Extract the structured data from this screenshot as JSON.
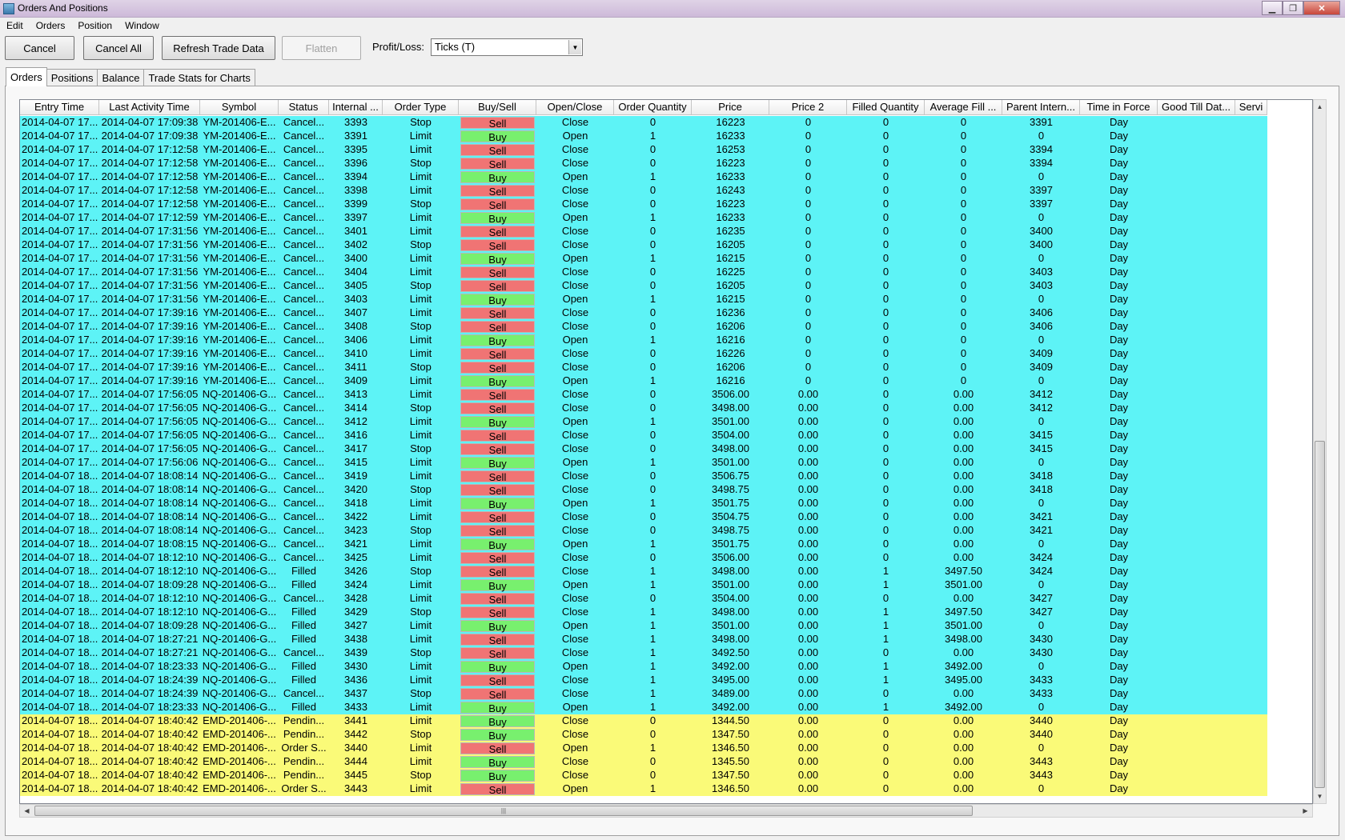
{
  "window": {
    "title": "Orders And Positions",
    "minimize": "▁",
    "restore": "❐",
    "close": "✕"
  },
  "menu": [
    "Edit",
    "Orders",
    "Position",
    "Window"
  ],
  "toolbar": {
    "cancel": "Cancel",
    "cancel_all": "Cancel All",
    "refresh": "Refresh Trade Data",
    "flatten": "Flatten",
    "pl_label": "Profit/Loss:",
    "pl_value": "Ticks (T)"
  },
  "tabs": [
    "Orders",
    "Positions",
    "Balance",
    "Trade Stats for Charts"
  ],
  "colors": {
    "cyan_row": "#5df3f6",
    "yellow_row": "#fafa78",
    "sell": "#f07474",
    "buy": "#78f06e"
  },
  "columns": [
    "Entry Time",
    "Last Activity Time",
    "Symbol",
    "Status",
    "Internal ...",
    "Order Type",
    "Buy/Sell",
    "Open/Close",
    "Order Quantity",
    "Price",
    "Price 2",
    "Filled Quantity",
    "Average Fill ...",
    "Parent Intern...",
    "Time in Force",
    "Good Till Dat...",
    "Servi"
  ],
  "rows": [
    [
      "2014-04-07 17...",
      "2014-04-07 17:09:38",
      "YM-201406-E...",
      "Cancel...",
      "3393",
      "Stop",
      "Sell",
      "Close",
      "0",
      "16223",
      "0",
      "0",
      "0",
      "3391",
      "Day",
      "",
      ""
    ],
    [
      "2014-04-07 17...",
      "2014-04-07 17:09:38",
      "YM-201406-E...",
      "Cancel...",
      "3391",
      "Limit",
      "Buy",
      "Open",
      "1",
      "16233",
      "0",
      "0",
      "0",
      "0",
      "Day",
      "",
      ""
    ],
    [
      "2014-04-07 17...",
      "2014-04-07 17:12:58",
      "YM-201406-E...",
      "Cancel...",
      "3395",
      "Limit",
      "Sell",
      "Close",
      "0",
      "16253",
      "0",
      "0",
      "0",
      "3394",
      "Day",
      "",
      ""
    ],
    [
      "2014-04-07 17...",
      "2014-04-07 17:12:58",
      "YM-201406-E...",
      "Cancel...",
      "3396",
      "Stop",
      "Sell",
      "Close",
      "0",
      "16223",
      "0",
      "0",
      "0",
      "3394",
      "Day",
      "",
      ""
    ],
    [
      "2014-04-07 17...",
      "2014-04-07 17:12:58",
      "YM-201406-E...",
      "Cancel...",
      "3394",
      "Limit",
      "Buy",
      "Open",
      "1",
      "16233",
      "0",
      "0",
      "0",
      "0",
      "Day",
      "",
      ""
    ],
    [
      "2014-04-07 17...",
      "2014-04-07 17:12:58",
      "YM-201406-E...",
      "Cancel...",
      "3398",
      "Limit",
      "Sell",
      "Close",
      "0",
      "16243",
      "0",
      "0",
      "0",
      "3397",
      "Day",
      "",
      ""
    ],
    [
      "2014-04-07 17...",
      "2014-04-07 17:12:58",
      "YM-201406-E...",
      "Cancel...",
      "3399",
      "Stop",
      "Sell",
      "Close",
      "0",
      "16223",
      "0",
      "0",
      "0",
      "3397",
      "Day",
      "",
      ""
    ],
    [
      "2014-04-07 17...",
      "2014-04-07 17:12:59",
      "YM-201406-E...",
      "Cancel...",
      "3397",
      "Limit",
      "Buy",
      "Open",
      "1",
      "16233",
      "0",
      "0",
      "0",
      "0",
      "Day",
      "",
      ""
    ],
    [
      "2014-04-07 17...",
      "2014-04-07 17:31:56",
      "YM-201406-E...",
      "Cancel...",
      "3401",
      "Limit",
      "Sell",
      "Close",
      "0",
      "16235",
      "0",
      "0",
      "0",
      "3400",
      "Day",
      "",
      ""
    ],
    [
      "2014-04-07 17...",
      "2014-04-07 17:31:56",
      "YM-201406-E...",
      "Cancel...",
      "3402",
      "Stop",
      "Sell",
      "Close",
      "0",
      "16205",
      "0",
      "0",
      "0",
      "3400",
      "Day",
      "",
      ""
    ],
    [
      "2014-04-07 17...",
      "2014-04-07 17:31:56",
      "YM-201406-E...",
      "Cancel...",
      "3400",
      "Limit",
      "Buy",
      "Open",
      "1",
      "16215",
      "0",
      "0",
      "0",
      "0",
      "Day",
      "",
      ""
    ],
    [
      "2014-04-07 17...",
      "2014-04-07 17:31:56",
      "YM-201406-E...",
      "Cancel...",
      "3404",
      "Limit",
      "Sell",
      "Close",
      "0",
      "16225",
      "0",
      "0",
      "0",
      "3403",
      "Day",
      "",
      ""
    ],
    [
      "2014-04-07 17...",
      "2014-04-07 17:31:56",
      "YM-201406-E...",
      "Cancel...",
      "3405",
      "Stop",
      "Sell",
      "Close",
      "0",
      "16205",
      "0",
      "0",
      "0",
      "3403",
      "Day",
      "",
      ""
    ],
    [
      "2014-04-07 17...",
      "2014-04-07 17:31:56",
      "YM-201406-E...",
      "Cancel...",
      "3403",
      "Limit",
      "Buy",
      "Open",
      "1",
      "16215",
      "0",
      "0",
      "0",
      "0",
      "Day",
      "",
      ""
    ],
    [
      "2014-04-07 17...",
      "2014-04-07 17:39:16",
      "YM-201406-E...",
      "Cancel...",
      "3407",
      "Limit",
      "Sell",
      "Close",
      "0",
      "16236",
      "0",
      "0",
      "0",
      "3406",
      "Day",
      "",
      ""
    ],
    [
      "2014-04-07 17...",
      "2014-04-07 17:39:16",
      "YM-201406-E...",
      "Cancel...",
      "3408",
      "Stop",
      "Sell",
      "Close",
      "0",
      "16206",
      "0",
      "0",
      "0",
      "3406",
      "Day",
      "",
      ""
    ],
    [
      "2014-04-07 17...",
      "2014-04-07 17:39:16",
      "YM-201406-E...",
      "Cancel...",
      "3406",
      "Limit",
      "Buy",
      "Open",
      "1",
      "16216",
      "0",
      "0",
      "0",
      "0",
      "Day",
      "",
      ""
    ],
    [
      "2014-04-07 17...",
      "2014-04-07 17:39:16",
      "YM-201406-E...",
      "Cancel...",
      "3410",
      "Limit",
      "Sell",
      "Close",
      "0",
      "16226",
      "0",
      "0",
      "0",
      "3409",
      "Day",
      "",
      ""
    ],
    [
      "2014-04-07 17...",
      "2014-04-07 17:39:16",
      "YM-201406-E...",
      "Cancel...",
      "3411",
      "Stop",
      "Sell",
      "Close",
      "0",
      "16206",
      "0",
      "0",
      "0",
      "3409",
      "Day",
      "",
      ""
    ],
    [
      "2014-04-07 17...",
      "2014-04-07 17:39:16",
      "YM-201406-E...",
      "Cancel...",
      "3409",
      "Limit",
      "Buy",
      "Open",
      "1",
      "16216",
      "0",
      "0",
      "0",
      "0",
      "Day",
      "",
      ""
    ],
    [
      "2014-04-07 17...",
      "2014-04-07 17:56:05",
      "NQ-201406-G...",
      "Cancel...",
      "3413",
      "Limit",
      "Sell",
      "Close",
      "0",
      "3506.00",
      "0.00",
      "0",
      "0.00",
      "3412",
      "Day",
      "",
      ""
    ],
    [
      "2014-04-07 17...",
      "2014-04-07 17:56:05",
      "NQ-201406-G...",
      "Cancel...",
      "3414",
      "Stop",
      "Sell",
      "Close",
      "0",
      "3498.00",
      "0.00",
      "0",
      "0.00",
      "3412",
      "Day",
      "",
      ""
    ],
    [
      "2014-04-07 17...",
      "2014-04-07 17:56:05",
      "NQ-201406-G...",
      "Cancel...",
      "3412",
      "Limit",
      "Buy",
      "Open",
      "1",
      "3501.00",
      "0.00",
      "0",
      "0.00",
      "0",
      "Day",
      "",
      ""
    ],
    [
      "2014-04-07 17...",
      "2014-04-07 17:56:05",
      "NQ-201406-G...",
      "Cancel...",
      "3416",
      "Limit",
      "Sell",
      "Close",
      "0",
      "3504.00",
      "0.00",
      "0",
      "0.00",
      "3415",
      "Day",
      "",
      ""
    ],
    [
      "2014-04-07 17...",
      "2014-04-07 17:56:05",
      "NQ-201406-G...",
      "Cancel...",
      "3417",
      "Stop",
      "Sell",
      "Close",
      "0",
      "3498.00",
      "0.00",
      "0",
      "0.00",
      "3415",
      "Day",
      "",
      ""
    ],
    [
      "2014-04-07 17...",
      "2014-04-07 17:56:06",
      "NQ-201406-G...",
      "Cancel...",
      "3415",
      "Limit",
      "Buy",
      "Open",
      "1",
      "3501.00",
      "0.00",
      "0",
      "0.00",
      "0",
      "Day",
      "",
      ""
    ],
    [
      "2014-04-07 18...",
      "2014-04-07 18:08:14",
      "NQ-201406-G...",
      "Cancel...",
      "3419",
      "Limit",
      "Sell",
      "Close",
      "0",
      "3506.75",
      "0.00",
      "0",
      "0.00",
      "3418",
      "Day",
      "",
      ""
    ],
    [
      "2014-04-07 18...",
      "2014-04-07 18:08:14",
      "NQ-201406-G...",
      "Cancel...",
      "3420",
      "Stop",
      "Sell",
      "Close",
      "0",
      "3498.75",
      "0.00",
      "0",
      "0.00",
      "3418",
      "Day",
      "",
      ""
    ],
    [
      "2014-04-07 18...",
      "2014-04-07 18:08:14",
      "NQ-201406-G...",
      "Cancel...",
      "3418",
      "Limit",
      "Buy",
      "Open",
      "1",
      "3501.75",
      "0.00",
      "0",
      "0.00",
      "0",
      "Day",
      "",
      ""
    ],
    [
      "2014-04-07 18...",
      "2014-04-07 18:08:14",
      "NQ-201406-G...",
      "Cancel...",
      "3422",
      "Limit",
      "Sell",
      "Close",
      "0",
      "3504.75",
      "0.00",
      "0",
      "0.00",
      "3421",
      "Day",
      "",
      ""
    ],
    [
      "2014-04-07 18...",
      "2014-04-07 18:08:14",
      "NQ-201406-G...",
      "Cancel...",
      "3423",
      "Stop",
      "Sell",
      "Close",
      "0",
      "3498.75",
      "0.00",
      "0",
      "0.00",
      "3421",
      "Day",
      "",
      ""
    ],
    [
      "2014-04-07 18...",
      "2014-04-07 18:08:15",
      "NQ-201406-G...",
      "Cancel...",
      "3421",
      "Limit",
      "Buy",
      "Open",
      "1",
      "3501.75",
      "0.00",
      "0",
      "0.00",
      "0",
      "Day",
      "",
      ""
    ],
    [
      "2014-04-07 18...",
      "2014-04-07 18:12:10",
      "NQ-201406-G...",
      "Cancel...",
      "3425",
      "Limit",
      "Sell",
      "Close",
      "0",
      "3506.00",
      "0.00",
      "0",
      "0.00",
      "3424",
      "Day",
      "",
      ""
    ],
    [
      "2014-04-07 18...",
      "2014-04-07 18:12:10",
      "NQ-201406-G...",
      "Filled",
      "3426",
      "Stop",
      "Sell",
      "Close",
      "1",
      "3498.00",
      "0.00",
      "1",
      "3497.50",
      "3424",
      "Day",
      "",
      ""
    ],
    [
      "2014-04-07 18...",
      "2014-04-07 18:09:28",
      "NQ-201406-G...",
      "Filled",
      "3424",
      "Limit",
      "Buy",
      "Open",
      "1",
      "3501.00",
      "0.00",
      "1",
      "3501.00",
      "0",
      "Day",
      "",
      ""
    ],
    [
      "2014-04-07 18...",
      "2014-04-07 18:12:10",
      "NQ-201406-G...",
      "Cancel...",
      "3428",
      "Limit",
      "Sell",
      "Close",
      "0",
      "3504.00",
      "0.00",
      "0",
      "0.00",
      "3427",
      "Day",
      "",
      ""
    ],
    [
      "2014-04-07 18...",
      "2014-04-07 18:12:10",
      "NQ-201406-G...",
      "Filled",
      "3429",
      "Stop",
      "Sell",
      "Close",
      "1",
      "3498.00",
      "0.00",
      "1",
      "3497.50",
      "3427",
      "Day",
      "",
      ""
    ],
    [
      "2014-04-07 18...",
      "2014-04-07 18:09:28",
      "NQ-201406-G...",
      "Filled",
      "3427",
      "Limit",
      "Buy",
      "Open",
      "1",
      "3501.00",
      "0.00",
      "1",
      "3501.00",
      "0",
      "Day",
      "",
      ""
    ],
    [
      "2014-04-07 18...",
      "2014-04-07 18:27:21",
      "NQ-201406-G...",
      "Filled",
      "3438",
      "Limit",
      "Sell",
      "Close",
      "1",
      "3498.00",
      "0.00",
      "1",
      "3498.00",
      "3430",
      "Day",
      "",
      ""
    ],
    [
      "2014-04-07 18...",
      "2014-04-07 18:27:21",
      "NQ-201406-G...",
      "Cancel...",
      "3439",
      "Stop",
      "Sell",
      "Close",
      "1",
      "3492.50",
      "0.00",
      "0",
      "0.00",
      "3430",
      "Day",
      "",
      ""
    ],
    [
      "2014-04-07 18...",
      "2014-04-07 18:23:33",
      "NQ-201406-G...",
      "Filled",
      "3430",
      "Limit",
      "Buy",
      "Open",
      "1",
      "3492.00",
      "0.00",
      "1",
      "3492.00",
      "0",
      "Day",
      "",
      ""
    ],
    [
      "2014-04-07 18...",
      "2014-04-07 18:24:39",
      "NQ-201406-G...",
      "Filled",
      "3436",
      "Limit",
      "Sell",
      "Close",
      "1",
      "3495.00",
      "0.00",
      "1",
      "3495.00",
      "3433",
      "Day",
      "",
      ""
    ],
    [
      "2014-04-07 18...",
      "2014-04-07 18:24:39",
      "NQ-201406-G...",
      "Cancel...",
      "3437",
      "Stop",
      "Sell",
      "Close",
      "1",
      "3489.00",
      "0.00",
      "0",
      "0.00",
      "3433",
      "Day",
      "",
      ""
    ],
    [
      "2014-04-07 18...",
      "2014-04-07 18:23:33",
      "NQ-201406-G...",
      "Filled",
      "3433",
      "Limit",
      "Buy",
      "Open",
      "1",
      "3492.00",
      "0.00",
      "1",
      "3492.00",
      "0",
      "Day",
      "",
      ""
    ],
    [
      "2014-04-07 18...",
      "2014-04-07 18:40:42",
      "EMD-201406-...",
      "Pendin...",
      "3441",
      "Limit",
      "Buy",
      "Close",
      "0",
      "1344.50",
      "0.00",
      "0",
      "0.00",
      "3440",
      "Day",
      "",
      ""
    ],
    [
      "2014-04-07 18...",
      "2014-04-07 18:40:42",
      "EMD-201406-...",
      "Pendin...",
      "3442",
      "Stop",
      "Buy",
      "Close",
      "0",
      "1347.50",
      "0.00",
      "0",
      "0.00",
      "3440",
      "Day",
      "",
      ""
    ],
    [
      "2014-04-07 18...",
      "2014-04-07 18:40:42",
      "EMD-201406-...",
      "Order S...",
      "3440",
      "Limit",
      "Sell",
      "Open",
      "1",
      "1346.50",
      "0.00",
      "0",
      "0.00",
      "0",
      "Day",
      "",
      ""
    ],
    [
      "2014-04-07 18...",
      "2014-04-07 18:40:42",
      "EMD-201406-...",
      "Pendin...",
      "3444",
      "Limit",
      "Buy",
      "Close",
      "0",
      "1345.50",
      "0.00",
      "0",
      "0.00",
      "3443",
      "Day",
      "",
      ""
    ],
    [
      "2014-04-07 18...",
      "2014-04-07 18:40:42",
      "EMD-201406-...",
      "Pendin...",
      "3445",
      "Stop",
      "Buy",
      "Close",
      "0",
      "1347.50",
      "0.00",
      "0",
      "0.00",
      "3443",
      "Day",
      "",
      ""
    ],
    [
      "2014-04-07 18...",
      "2014-04-07 18:40:42",
      "EMD-201406-...",
      "Order S...",
      "3443",
      "Limit",
      "Sell",
      "Open",
      "1",
      "1346.50",
      "0.00",
      "0",
      "0.00",
      "0",
      "Day",
      "",
      ""
    ]
  ]
}
